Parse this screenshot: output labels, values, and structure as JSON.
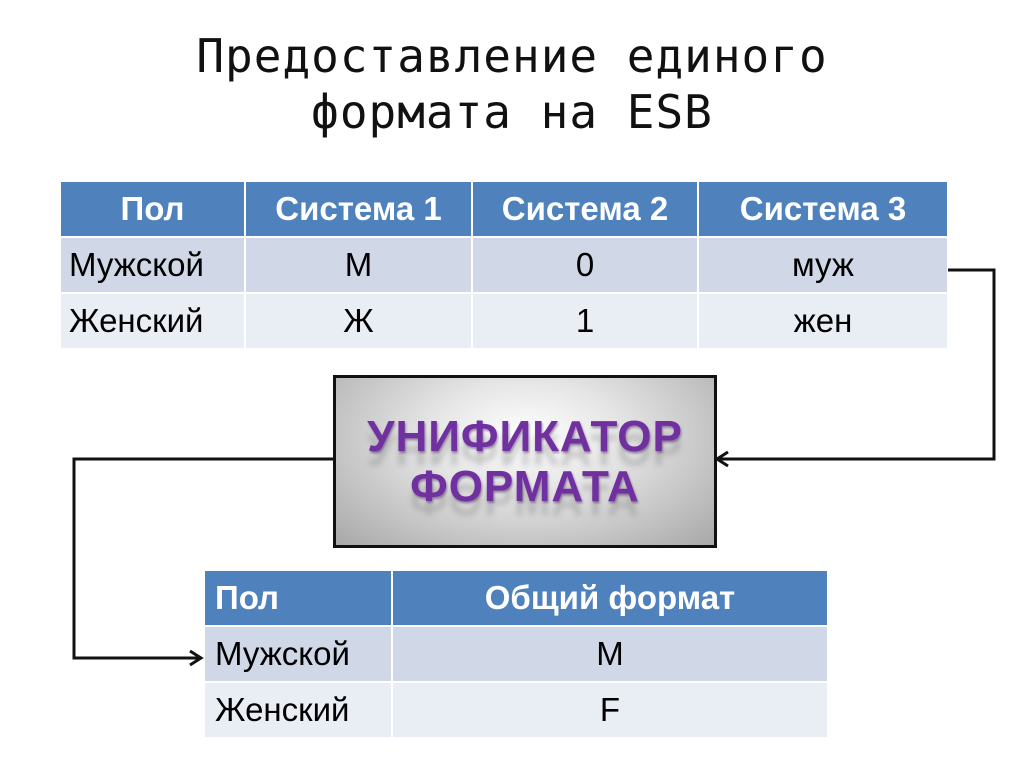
{
  "title": {
    "line1": "Предоставление единого",
    "line2": "формата на ESB"
  },
  "source_table": {
    "headers": [
      "Пол",
      "Система 1",
      "Система 2",
      "Система 3"
    ],
    "rows": [
      [
        "Мужской",
        "М",
        "0",
        "муж"
      ],
      [
        "Женский",
        "Ж",
        "1",
        "жен"
      ]
    ]
  },
  "unifier": {
    "line1": "УНИФИКАТОР",
    "line2": "ФОРМАТА",
    "text_color": "#7030a0"
  },
  "target_table": {
    "headers": [
      "Пол",
      "Общий формат"
    ],
    "rows": [
      [
        "Мужской",
        "M"
      ],
      [
        "Женский",
        "F"
      ]
    ]
  },
  "colors": {
    "header_bg": "#4f81bd",
    "row_odd_bg": "#d0d8e8",
    "row_even_bg": "#e9edf4"
  },
  "connectors": [
    {
      "from": "source_table.row.Мужской",
      "to": "unifier",
      "arrow": "arrow-left-icon"
    },
    {
      "from": "unifier",
      "to": "target_table.row.Мужской",
      "arrow": "arrow-right-icon"
    }
  ]
}
